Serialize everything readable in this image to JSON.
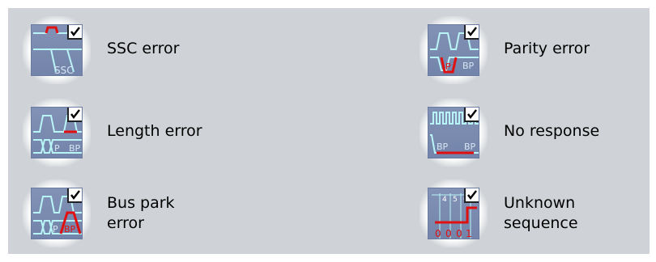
{
  "items": [
    {
      "label": "SSC error",
      "checked": true,
      "icon": "ssc-error-icon"
    },
    {
      "label": "Length error",
      "checked": true,
      "icon": "length-error-icon"
    },
    {
      "label": "Bus park\nerror",
      "checked": true,
      "icon": "bus-park-error-icon"
    },
    {
      "label": "Parity error",
      "checked": true,
      "icon": "parity-error-icon"
    },
    {
      "label": "No response",
      "checked": true,
      "icon": "no-response-icon"
    },
    {
      "label": "Unknown\nsequence",
      "checked": true,
      "icon": "unknown-sequence-icon"
    }
  ],
  "icon_text": {
    "ssc": "SSC",
    "p": "P",
    "bp": "BP",
    "seq_top": [
      "4",
      "5",
      "6"
    ],
    "seq_bits": [
      "0",
      "0",
      "0",
      "1"
    ]
  },
  "colors": {
    "panel": "#cfd3d7",
    "icon_bg": "#7a8bb0",
    "signal": "#b9f4f6",
    "error": "#e01010"
  }
}
